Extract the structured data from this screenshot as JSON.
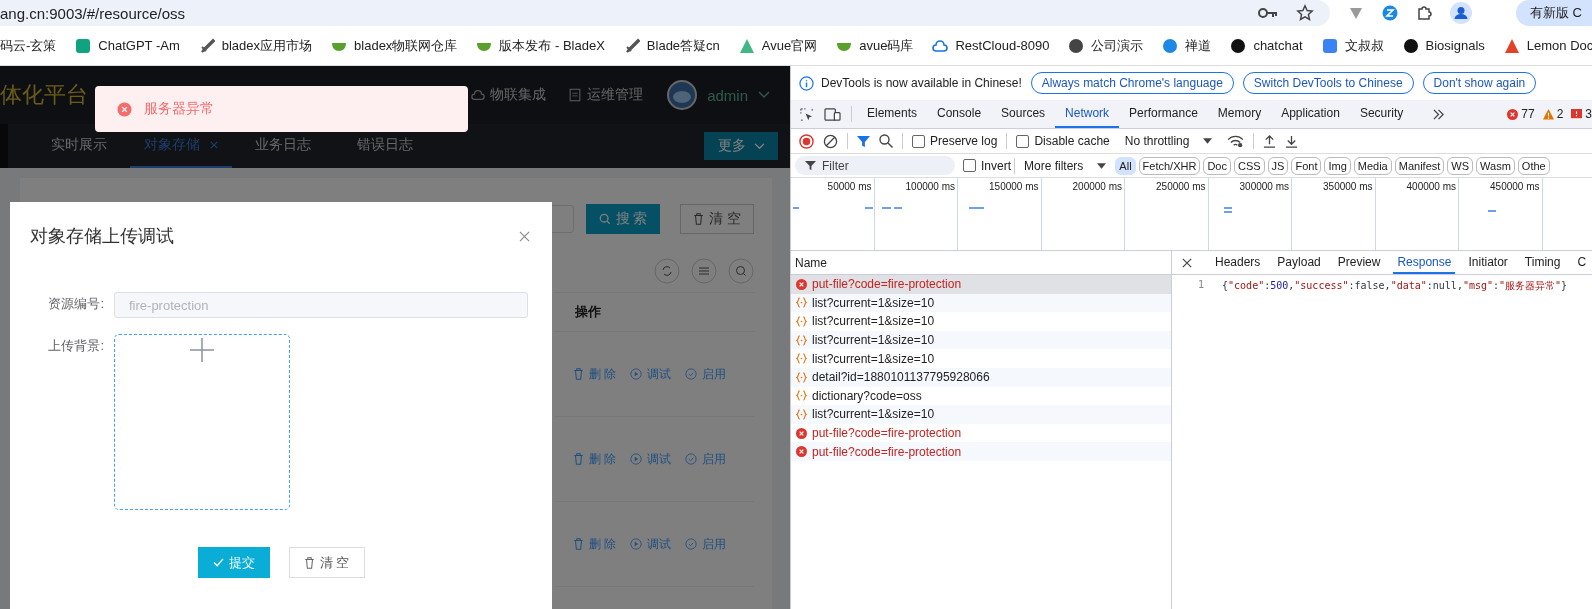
{
  "browser": {
    "address": "ang.cn:9003/#/resource/oss",
    "update_button": "有新版 C"
  },
  "bookmarks": [
    {
      "label": "码云-玄策"
    },
    {
      "label": "ChatGPT -Am",
      "kind": "square",
      "color": "#10a37f"
    },
    {
      "label": "bladex应用市场",
      "kind": "sword",
      "color": "#555555"
    },
    {
      "label": "bladex物联网仓库",
      "kind": "leaf",
      "color": "#5aa02c"
    },
    {
      "label": "版本发布 - BladeX",
      "kind": "leaf",
      "color": "#5aa02c"
    },
    {
      "label": "Blade答疑cn",
      "kind": "sword",
      "color": "#555555"
    },
    {
      "label": "Avue官网",
      "kind": "triangle",
      "color": "#41b883"
    },
    {
      "label": "avue码库",
      "kind": "leaf",
      "color": "#5aa02c"
    },
    {
      "label": "RestCloud-8090",
      "kind": "cloud",
      "color": "#1a73e8"
    },
    {
      "label": "公司演示",
      "kind": "circle",
      "color": "#444444"
    },
    {
      "label": "禅道",
      "kind": "circle",
      "color": "#1e88e5"
    },
    {
      "label": "chatchat",
      "kind": "circle",
      "color": "#111111"
    },
    {
      "label": "文叔叔",
      "kind": "square",
      "color": "#3b82f6"
    },
    {
      "label": "Biosignals",
      "kind": "circle",
      "color": "#111111"
    },
    {
      "label": "Lemon Doc",
      "kind": "triangle",
      "color": "#e24329"
    }
  ],
  "app": {
    "brand": "体化平台",
    "nav": [
      {
        "label": "物联集成",
        "kind": "cloud"
      },
      {
        "label": "运维管理",
        "kind": "doc"
      }
    ],
    "user": "admin",
    "tabs": [
      {
        "label": "实时展示",
        "selected": false
      },
      {
        "label": "对象存储",
        "selected": true
      },
      {
        "label": "业务日志",
        "selected": false
      },
      {
        "label": "错误日志",
        "selected": false
      }
    ],
    "more_button": "更多",
    "search_button": "搜 索",
    "clear_button": "清 空",
    "table_header": "操作",
    "rows": [
      {
        "actions": [
          "删 除",
          "调试",
          "启用"
        ]
      },
      {
        "actions": [
          "删 除",
          "调试",
          "启用"
        ]
      },
      {
        "actions": [
          "删 除",
          "调试",
          "启用"
        ]
      }
    ]
  },
  "toast": {
    "kind": "error",
    "message": "服务器异常"
  },
  "dialog": {
    "title": "对象存储上传调试",
    "fields": [
      {
        "kind": "input",
        "label": "资源编号:",
        "value": "fire-protection",
        "disabled": true
      },
      {
        "kind": "upload",
        "label": "上传背景:"
      }
    ],
    "submit": "提交",
    "clear": "清 空"
  },
  "devtools": {
    "notice": "DevTools is now available in Chinese!",
    "notice_buttons": [
      "Always match Chrome's language",
      "Switch DevTools to Chinese",
      "Don't show again"
    ],
    "tabs": [
      {
        "label": "Elements",
        "selected": false
      },
      {
        "label": "Console",
        "selected": false
      },
      {
        "label": "Sources",
        "selected": false
      },
      {
        "label": "Network",
        "selected": true
      },
      {
        "label": "Performance",
        "selected": false
      },
      {
        "label": "Memory",
        "selected": false
      },
      {
        "label": "Application",
        "selected": false
      },
      {
        "label": "Security",
        "selected": false
      }
    ],
    "counts": [
      {
        "kind": "error",
        "value": "77"
      },
      {
        "kind": "warning",
        "value": "2"
      },
      {
        "kind": "issue",
        "value": "3"
      }
    ],
    "preserve_log": {
      "label": "Preserve log",
      "checked": false
    },
    "disable_cache": {
      "label": "Disable cache",
      "checked": false
    },
    "throttling": "No throttling",
    "filter_placeholder": "Filter",
    "invert": {
      "label": "Invert",
      "checked": false
    },
    "more_filters": "More filters",
    "type_filters": [
      {
        "label": "All",
        "selected": true
      },
      {
        "label": "Fetch/XHR",
        "selected": false
      },
      {
        "label": "Doc",
        "selected": false
      },
      {
        "label": "CSS",
        "selected": false
      },
      {
        "label": "JS",
        "selected": false
      },
      {
        "label": "Font",
        "selected": false
      },
      {
        "label": "Img",
        "selected": false
      },
      {
        "label": "Media",
        "selected": false
      },
      {
        "label": "Manifest",
        "selected": false
      },
      {
        "label": "WS",
        "selected": false
      },
      {
        "label": "Wasm",
        "selected": false
      },
      {
        "label": "Othe",
        "selected": false
      }
    ],
    "timeline_ticks": [
      "50000 ms",
      "100000 ms",
      "150000 ms",
      "200000 ms",
      "250000 ms",
      "300000 ms",
      "350000 ms",
      "400000 ms",
      "450000 ms"
    ],
    "requests_header": "Name",
    "requests": [
      {
        "name": "put-file?code=fire-protection",
        "kind": "error",
        "selected": true
      },
      {
        "name": "list?current=1&size=10",
        "kind": "fetch",
        "selected": false
      },
      {
        "name": "list?current=1&size=10",
        "kind": "fetch",
        "selected": false
      },
      {
        "name": "list?current=1&size=10",
        "kind": "fetch",
        "selected": false
      },
      {
        "name": "list?current=1&size=10",
        "kind": "fetch",
        "selected": false
      },
      {
        "name": "detail?id=1880101137795928066",
        "kind": "fetch",
        "selected": false
      },
      {
        "name": "dictionary?code=oss",
        "kind": "fetch",
        "selected": false
      },
      {
        "name": "list?current=1&size=10",
        "kind": "fetch",
        "selected": false
      },
      {
        "name": "put-file?code=fire-protection",
        "kind": "error",
        "selected": false
      },
      {
        "name": "put-file?code=fire-protection",
        "kind": "error",
        "selected": false
      }
    ],
    "detail_tabs": [
      {
        "label": "Headers",
        "selected": false
      },
      {
        "label": "Payload",
        "selected": false
      },
      {
        "label": "Preview",
        "selected": false
      },
      {
        "label": "Response",
        "selected": true
      },
      {
        "label": "Initiator",
        "selected": false
      },
      {
        "label": "Timing",
        "selected": false
      },
      {
        "label": "C",
        "selected": false
      }
    ],
    "response": {
      "line": "1",
      "tokens": [
        {
          "text": "{",
          "kind": "punct"
        },
        {
          "text": "\"code\"",
          "kind": "string"
        },
        {
          "text": ":",
          "kind": "punct"
        },
        {
          "text": "500",
          "kind": "number"
        },
        {
          "text": ",",
          "kind": "punct"
        },
        {
          "text": "\"success\"",
          "kind": "string"
        },
        {
          "text": ":false,",
          "kind": "punct"
        },
        {
          "text": "\"data\"",
          "kind": "string"
        },
        {
          "text": ":null,",
          "kind": "punct"
        },
        {
          "text": "\"msg\"",
          "kind": "string"
        },
        {
          "text": ":",
          "kind": "punct"
        },
        {
          "text": "\"服务器异常\"",
          "kind": "string"
        },
        {
          "text": "}",
          "kind": "punct"
        }
      ]
    }
  }
}
